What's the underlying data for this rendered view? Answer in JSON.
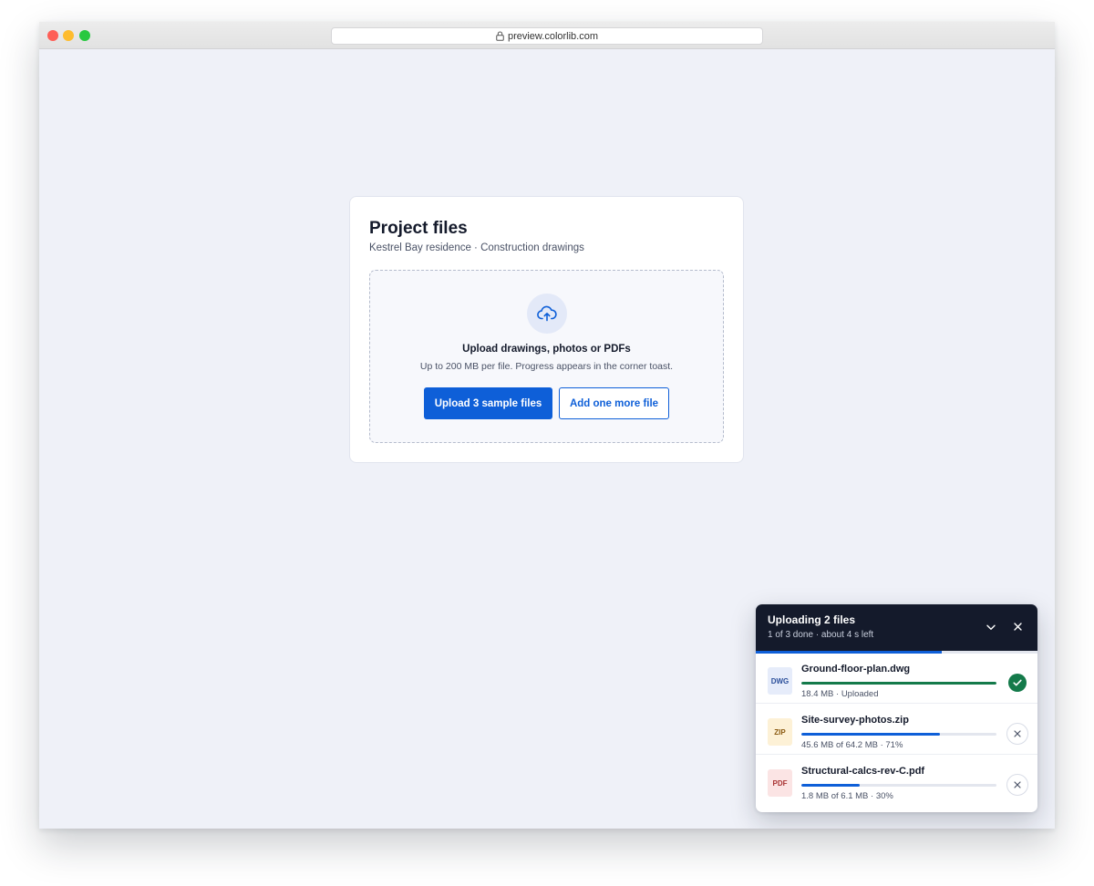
{
  "browser": {
    "url": "preview.colorlib.com"
  },
  "card": {
    "title": "Project files",
    "subtitle": "Kestrel Bay residence · Construction drawings",
    "dropzone": {
      "icon": "cloud-upload-icon",
      "title": "Upload drawings, photos or PDFs",
      "hint": "Up to 200 MB per file. Progress appears in the corner toast.",
      "primary_button": "Upload 3 sample files",
      "secondary_button": "Add one more file"
    }
  },
  "toast": {
    "title": "Uploading 2 files",
    "status": "1 of 3 done · about 4 s left",
    "overall_progress": 0.66,
    "files": [
      {
        "type_label": "DWG",
        "name": "Ground-floor-plan.dwg",
        "meta": "18.4 MB · Uploaded",
        "progress": 1.0,
        "state": "done",
        "bar_color": "#147a4a",
        "badge_bg": "#e6ecfa",
        "badge_fg": "#2b4f9a"
      },
      {
        "type_label": "ZIP",
        "name": "Site-survey-photos.zip",
        "meta": "45.6 MB of 64.2 MB · 71%",
        "progress": 0.71,
        "state": "uploading",
        "bar_color": "#0e5fd8",
        "badge_bg": "#fdf1d6",
        "badge_fg": "#8a5a10"
      },
      {
        "type_label": "PDF",
        "name": "Structural-calcs-rev-C.pdf",
        "meta": "1.8 MB of 6.1 MB · 30%",
        "progress": 0.3,
        "state": "uploading",
        "bar_color": "#0e5fd8",
        "badge_bg": "#fbe4e4",
        "badge_fg": "#a83232"
      }
    ]
  },
  "colors": {
    "accent": "#0e5fd8",
    "success": "#147a4a",
    "toast_header": "#141a2b",
    "page_background": "#eff1f8"
  }
}
